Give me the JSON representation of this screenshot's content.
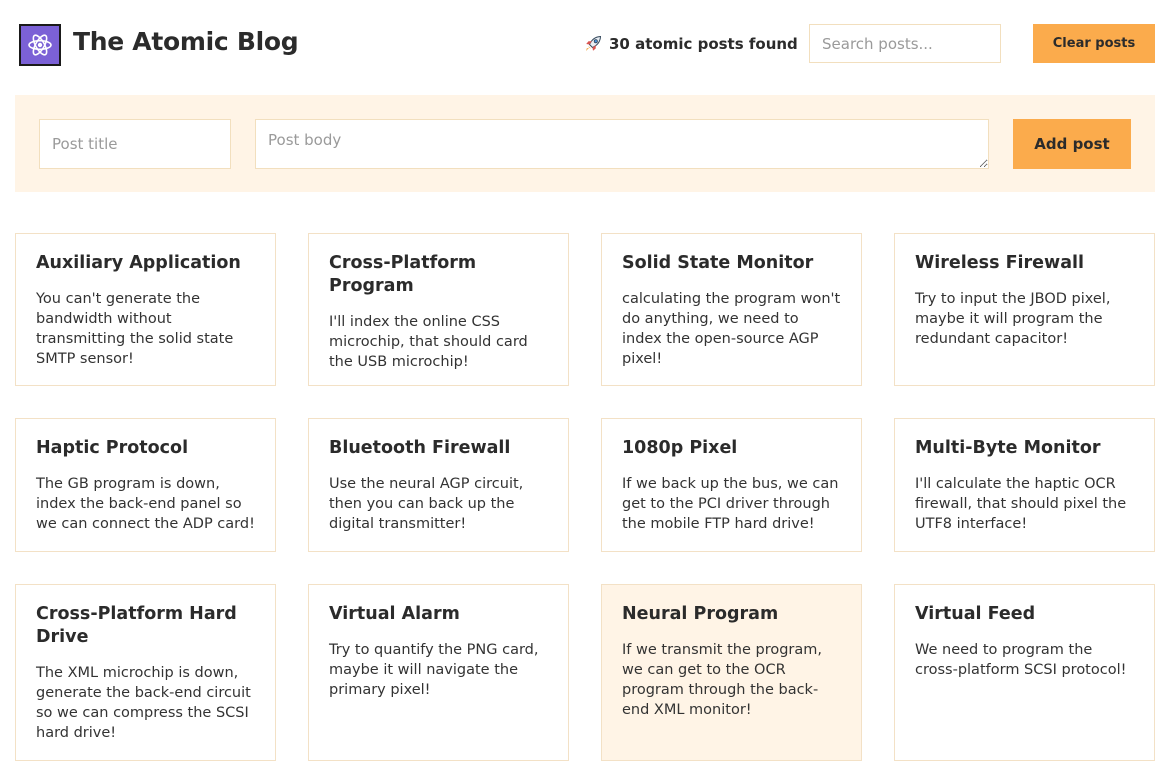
{
  "header": {
    "title": "The Atomic Blog",
    "logo_icon": "atom-icon",
    "post_count_icon": "rocket-icon",
    "post_count_text": "30 atomic posts found",
    "search_placeholder": "Search posts...",
    "search_value": "",
    "clear_label": "Clear posts"
  },
  "compose": {
    "title_placeholder": "Post title",
    "title_value": "",
    "body_placeholder": "Post body",
    "body_value": "",
    "add_label": "Add post"
  },
  "colors": {
    "accent": "#fbab4c",
    "panel": "#fff4e6",
    "border": "#f3e1c6",
    "logo_bg": "#7b61d6"
  },
  "posts": [
    {
      "title": "Auxiliary Application",
      "body": "You can't generate the bandwidth without transmitting the solid state SMTP sensor!"
    },
    {
      "title": "Cross-Platform Program",
      "body": "I'll index the online CSS microchip, that should card the USB microchip!"
    },
    {
      "title": "Solid State Monitor",
      "body": "calculating the program won't do anything, we need to index the open-source AGP pixel!"
    },
    {
      "title": "Wireless Firewall",
      "body": "Try to input the JBOD pixel, maybe it will program the redundant capacitor!"
    },
    {
      "title": "Haptic Protocol",
      "body": "The GB program is down, index the back-end panel so we can connect the ADP card!"
    },
    {
      "title": "Bluetooth Firewall",
      "body": "Use the neural AGP circuit, then you can back up the digital transmitter!"
    },
    {
      "title": "1080p Pixel",
      "body": "If we back up the bus, we can get to the PCI driver through the mobile FTP hard drive!"
    },
    {
      "title": "Multi-Byte Monitor",
      "body": "I'll calculate the haptic OCR firewall, that should pixel the UTF8 interface!"
    },
    {
      "title": "Cross-Platform Hard Drive",
      "body": "The XML microchip is down, generate the back-end circuit so we can compress the SCSI hard drive!"
    },
    {
      "title": "Virtual Alarm",
      "body": "Try to quantify the PNG card, maybe it will navigate the primary pixel!"
    },
    {
      "title": "Neural Program",
      "body": "If we transmit the program, we can get to the OCR program through the back-end XML monitor!"
    },
    {
      "title": "Virtual Feed",
      "body": "We need to program the cross-platform SCSI protocol!"
    }
  ]
}
